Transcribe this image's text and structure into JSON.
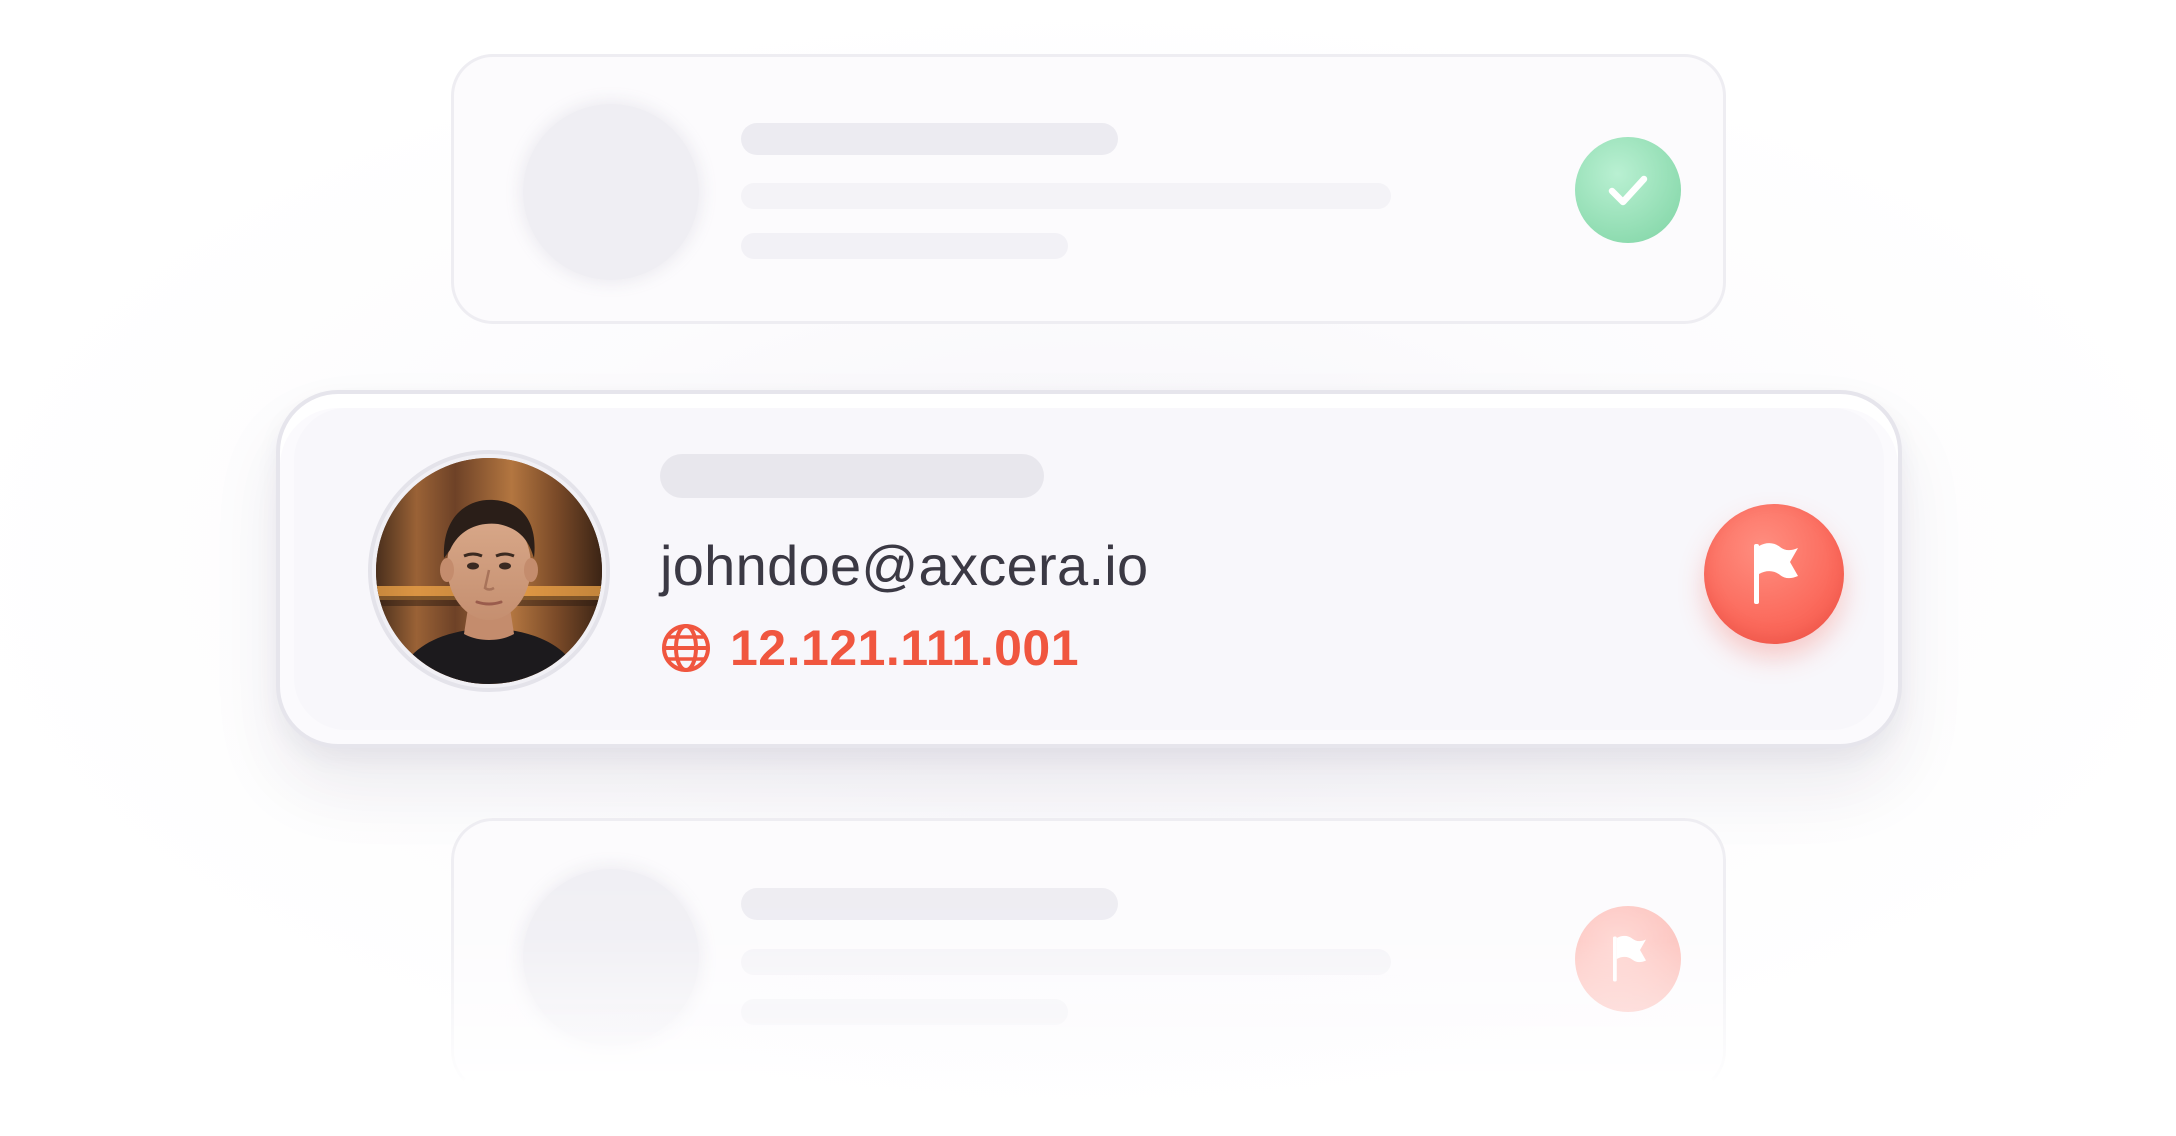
{
  "main_card": {
    "email": "johndoe@axcera.io",
    "ip_address": "12.121.111.001",
    "action_icon": "flag-icon",
    "ip_icon": "globe-icon"
  },
  "top_card": {
    "status_icon": "check-icon",
    "status_color": "#8fdcb1"
  },
  "bottom_card": {
    "status_icon": "flag-icon",
    "status_color": "#fcbdb7"
  },
  "colors": {
    "accent_red": "#f0563f",
    "flag_button": "#fb6a5c",
    "success_green": "#8fdcb1",
    "text_dark": "#3b3944"
  }
}
